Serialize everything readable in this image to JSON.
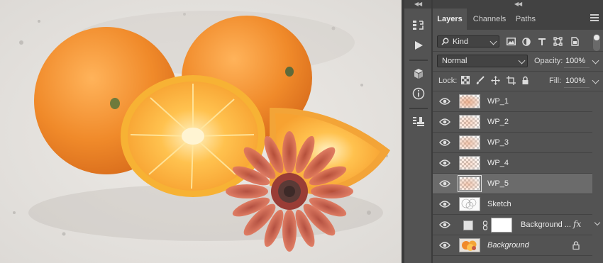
{
  "canvas": {
    "image_subject": "oranges-and-gerbera-sketch"
  },
  "panel": {
    "tabs": [
      {
        "label": "Layers",
        "active": true
      },
      {
        "label": "Channels",
        "active": false
      },
      {
        "label": "Paths",
        "active": false
      }
    ],
    "filter": {
      "kind_label": "Kind"
    },
    "blend_mode": "Normal",
    "opacity_label": "Opacity:",
    "opacity_value": "100%",
    "lock_label": "Lock:",
    "fill_label": "Fill:",
    "fill_value": "100%",
    "layers": [
      {
        "name": "WP_1",
        "selected": false
      },
      {
        "name": "WP_2",
        "selected": false
      },
      {
        "name": "WP_3",
        "selected": false
      },
      {
        "name": "WP_4",
        "selected": false
      },
      {
        "name": "WP_5",
        "selected": true
      },
      {
        "name": "Sketch",
        "selected": false
      },
      {
        "name": "Background ...",
        "selected": false,
        "has_fx": true,
        "fx_label": "fx"
      },
      {
        "name": "Background",
        "selected": false,
        "italic": true,
        "locked": true
      }
    ]
  },
  "colors": {
    "panel_bg": "#535353",
    "tab_bar": "#424242",
    "selected_row": "#6b6b6b"
  }
}
